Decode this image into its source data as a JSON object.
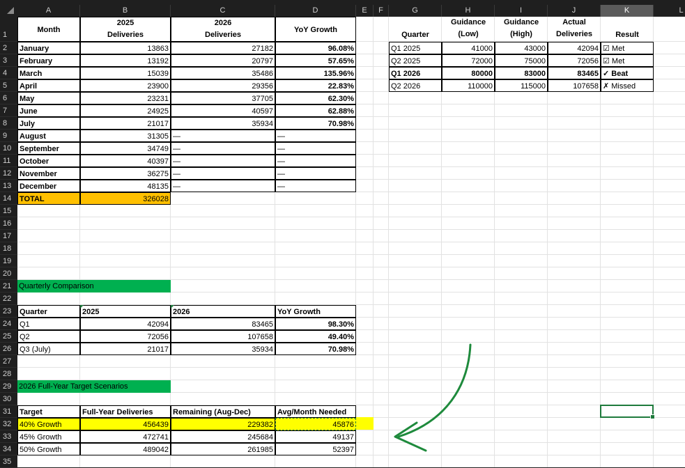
{
  "columns": [
    "A",
    "B",
    "C",
    "D",
    "E",
    "F",
    "G",
    "H",
    "I",
    "J",
    "K",
    "L"
  ],
  "selected_column": "K",
  "rows": [
    "1",
    "2",
    "3",
    "4",
    "5",
    "6",
    "7",
    "8",
    "9",
    "10",
    "11",
    "12",
    "13",
    "14",
    "15",
    "16",
    "17",
    "18",
    "19",
    "20",
    "21",
    "22",
    "23",
    "24",
    "25",
    "26",
    "27",
    "28",
    "29",
    "30",
    "31",
    "32",
    "33",
    "34",
    "35"
  ],
  "monthly": {
    "headers": {
      "month": "Month",
      "y2025_a": "2025",
      "y2025_b": "Deliveries",
      "y2026_a": "2026",
      "y2026_b": "Deliveries",
      "yoy": "YoY Growth"
    },
    "rows": [
      {
        "month": "January",
        "d2025": "13863",
        "d2026": "27182",
        "yoy": "96.08%"
      },
      {
        "month": "February",
        "d2025": "13192",
        "d2026": "20797",
        "yoy": "57.65%"
      },
      {
        "month": "March",
        "d2025": "15039",
        "d2026": "35486",
        "yoy": "135.96%"
      },
      {
        "month": "April",
        "d2025": "23900",
        "d2026": "29356",
        "yoy": "22.83%"
      },
      {
        "month": "May",
        "d2025": "23231",
        "d2026": "37705",
        "yoy": "62.30%"
      },
      {
        "month": "June",
        "d2025": "24925",
        "d2026": "40597",
        "yoy": "62.88%"
      },
      {
        "month": "July",
        "d2025": "21017",
        "d2026": "35934",
        "yoy": "70.98%"
      },
      {
        "month": "August",
        "d2025": "31305",
        "d2026": "—",
        "yoy": "—"
      },
      {
        "month": "September",
        "d2025": "34749",
        "d2026": "—",
        "yoy": "—"
      },
      {
        "month": "October",
        "d2025": "40397",
        "d2026": "—",
        "yoy": "—"
      },
      {
        "month": "November",
        "d2025": "36275",
        "d2026": "—",
        "yoy": "—"
      },
      {
        "month": "December",
        "d2025": "48135",
        "d2026": "—",
        "yoy": "—"
      }
    ],
    "total_label": "TOTAL",
    "total_value": "326028"
  },
  "guidance": {
    "headers": {
      "quarter": "Quarter",
      "low_a": "Guidance",
      "low_b": "(Low)",
      "high_a": "Guidance",
      "high_b": "(High)",
      "actual_a": "Actual",
      "actual_b": "Deliveries",
      "result": "Result"
    },
    "rows": [
      {
        "quarter": "Q1 2025",
        "low": "41000",
        "high": "43000",
        "actual": "42094",
        "result": "☑ Met",
        "bold": false
      },
      {
        "quarter": "Q2 2025",
        "low": "72000",
        "high": "75000",
        "actual": "72056",
        "result": "☑ Met",
        "bold": false
      },
      {
        "quarter": "Q1 2026",
        "low": "80000",
        "high": "83000",
        "actual": "83465",
        "result": "✓ Beat",
        "bold": true
      },
      {
        "quarter": "Q2 2026",
        "low": "110000",
        "high": "115000",
        "actual": "107658",
        "result": "✗ Missed",
        "bold": false
      }
    ]
  },
  "quarterly": {
    "title": "Quarterly Comparison",
    "headers": {
      "quarter": "Quarter",
      "y2025": "2025",
      "y2026": "2026",
      "yoy": "YoY Growth"
    },
    "rows": [
      {
        "quarter": "Q1",
        "v2025": "42094",
        "v2026": "83465",
        "yoy": "98.30%"
      },
      {
        "quarter": "Q2",
        "v2025": "72056",
        "v2026": "107658",
        "yoy": "49.40%"
      },
      {
        "quarter": "Q3 (July)",
        "v2025": "21017",
        "v2026": "35934",
        "yoy": "70.98%"
      }
    ]
  },
  "scenarios": {
    "title": "2026 Full-Year Target Scenarios",
    "headers": {
      "target": "Target",
      "full": "Full-Year Deliveries",
      "remaining": "Remaining (Aug-Dec)",
      "avg": "Avg/Month Needed"
    },
    "rows": [
      {
        "target": "40% Growth",
        "full": "456439",
        "remaining": "229382",
        "avg": "45876"
      },
      {
        "target": "45% Growth",
        "full": "472741",
        "remaining": "245684",
        "avg": "49137"
      },
      {
        "target": "50% Growth",
        "full": "489042",
        "remaining": "261985",
        "avg": "52397"
      }
    ]
  },
  "colors": {
    "accent_green": "#00b050",
    "highlight_yellow": "#ffff00",
    "total_orange": "#ffc000",
    "annotation": "#1e8a3c"
  }
}
